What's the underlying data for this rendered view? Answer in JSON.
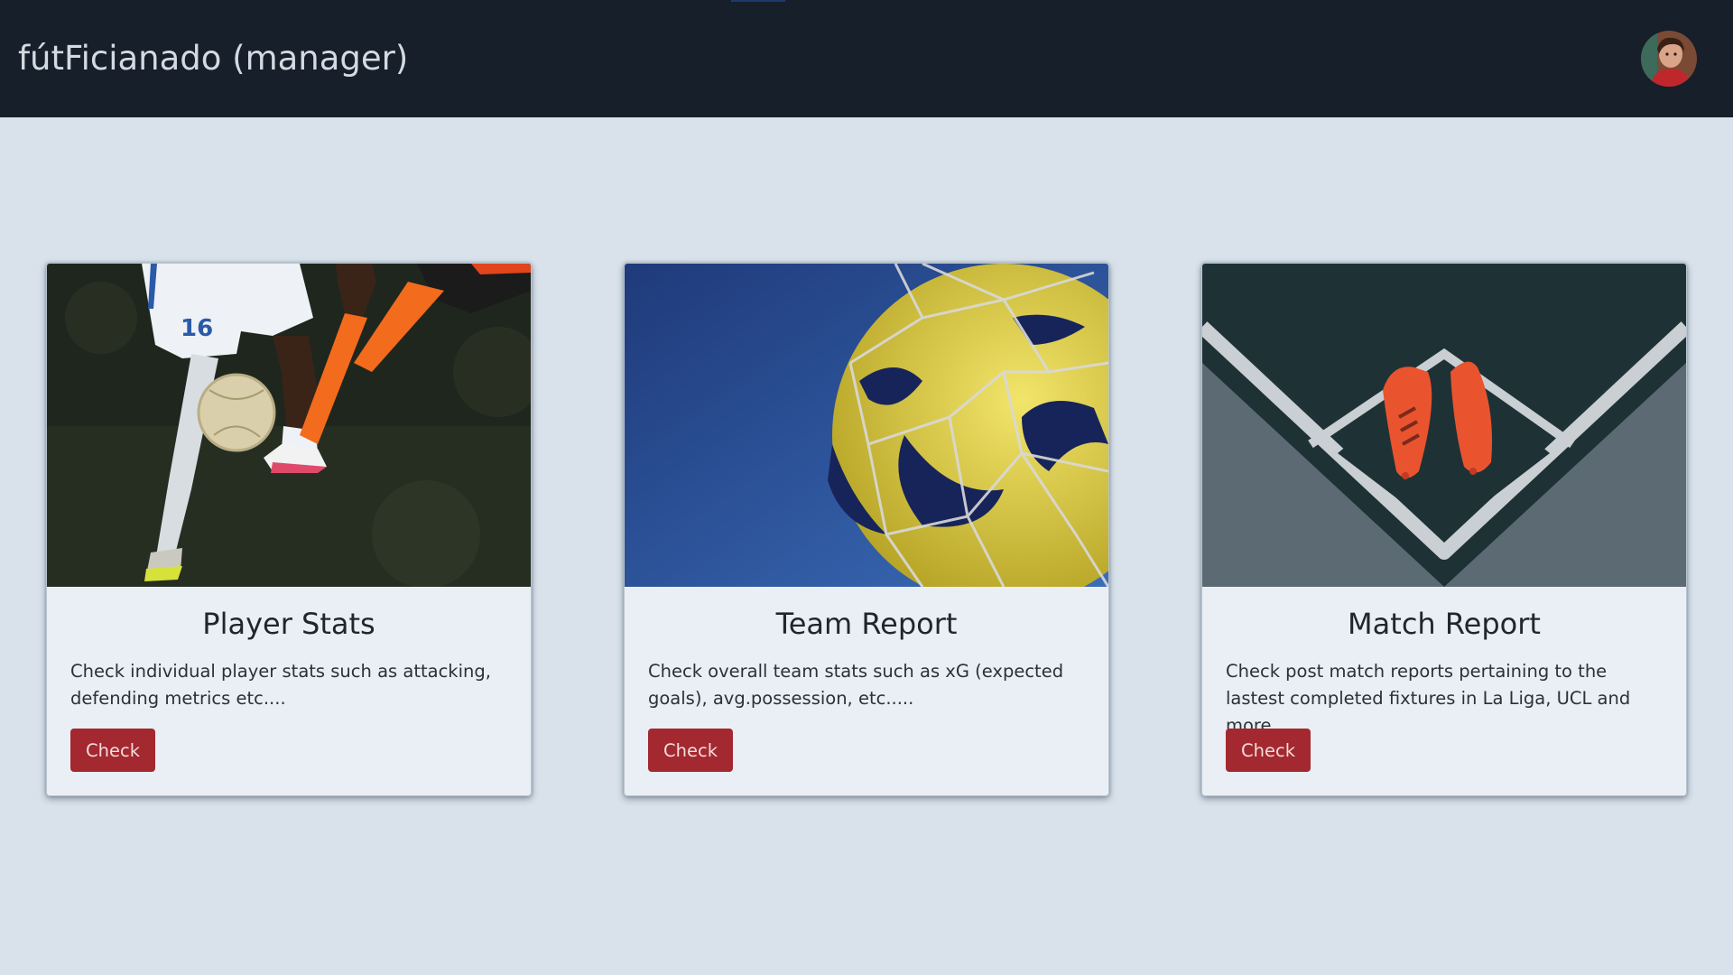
{
  "app": {
    "title": "fútFicianado (manager)"
  },
  "header": {
    "avatar_icon": "user-avatar"
  },
  "colors": {
    "navbar": "#161f2a",
    "page_background": "#d9e2eb",
    "card_background": "#e9eff5",
    "button": "#a3282f"
  },
  "cards": [
    {
      "title": "Player Stats",
      "description": "Check individual player stats such as attacking, defending metrics etc....",
      "button_label": "Check",
      "image_icon": "football-players-dribbling-image"
    },
    {
      "title": "Team Report",
      "description": "Check overall team stats such as xG (expected goals), avg.possession, etc.....",
      "button_label": "Check",
      "image_icon": "ball-in-net-image"
    },
    {
      "title": "Match Report",
      "description": "Check post match reports pertaining to the lastest completed fixtures in La Liga, UCL and more...",
      "button_label": "Check",
      "image_icon": "football-boots-on-pitch-image"
    }
  ]
}
